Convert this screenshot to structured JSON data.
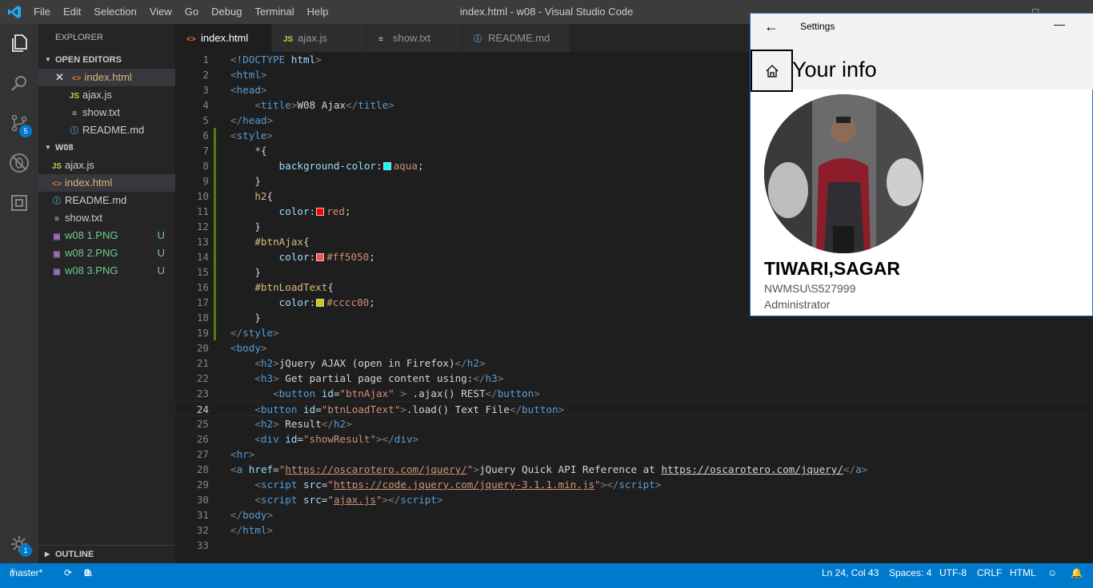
{
  "window": {
    "title": "index.html - w08 - Visual Studio Code",
    "menu": [
      "File",
      "Edit",
      "Selection",
      "View",
      "Go",
      "Debug",
      "Terminal",
      "Help"
    ]
  },
  "activity": {
    "scm_badge": "5",
    "settings_badge": "1"
  },
  "sidebar": {
    "title": "EXPLORER",
    "open_editors_label": "OPEN EDITORS",
    "open_editors": [
      {
        "name": "index.html",
        "icon": "html-icon"
      },
      {
        "name": "ajax.js",
        "icon": "js-icon"
      },
      {
        "name": "show.txt",
        "icon": "txt-icon"
      },
      {
        "name": "README.md",
        "icon": "info-icon"
      }
    ],
    "folder_label": "W08",
    "files": [
      {
        "name": "ajax.js",
        "icon": "js-icon",
        "status": ""
      },
      {
        "name": "index.html",
        "icon": "html-icon",
        "status": ""
      },
      {
        "name": "README.md",
        "icon": "info-icon",
        "status": ""
      },
      {
        "name": "show.txt",
        "icon": "txt-icon",
        "status": ""
      },
      {
        "name": "w08 1.PNG",
        "icon": "image-icon",
        "status": "U"
      },
      {
        "name": "w08 2.PNG",
        "icon": "image-icon",
        "status": "U"
      },
      {
        "name": "w08 3.PNG",
        "icon": "image-icon",
        "status": "U"
      }
    ],
    "outline_label": "OUTLINE"
  },
  "tabs": [
    {
      "label": "index.html",
      "icon": "html-icon",
      "active": true
    },
    {
      "label": "ajax.js",
      "icon": "js-icon",
      "active": false
    },
    {
      "label": "show.txt",
      "icon": "txt-icon",
      "active": false
    },
    {
      "label": "README.md",
      "icon": "info-icon",
      "active": false
    }
  ],
  "editor": {
    "current_line": 24,
    "lines": [
      "1",
      "2",
      "3",
      "4",
      "5",
      "6",
      "7",
      "8",
      "9",
      "10",
      "11",
      "12",
      "13",
      "14",
      "15",
      "16",
      "17",
      "18",
      "19",
      "20",
      "21",
      "22",
      "23",
      "24",
      "25",
      "26",
      "27",
      "28",
      "29",
      "30",
      "31",
      "32",
      "33"
    ]
  },
  "status": {
    "branch": "master*",
    "errors": "0",
    "warnings": "0",
    "position": "Ln 24, Col 43",
    "spaces": "Spaces: 4",
    "encoding": "UTF-8",
    "eol": "CRLF",
    "language": "HTML"
  },
  "settings_window": {
    "title": "Settings",
    "page_title": "Your info",
    "user_name": "TIWARI,SAGAR",
    "account": "NWMSU\\S527999",
    "role": "Administrator"
  },
  "colors": {
    "accent": "#007acc",
    "aqua": "#00ffff",
    "red": "#ff0000",
    "ff5050": "#ff5050",
    "cccc00": "#cccc00"
  }
}
